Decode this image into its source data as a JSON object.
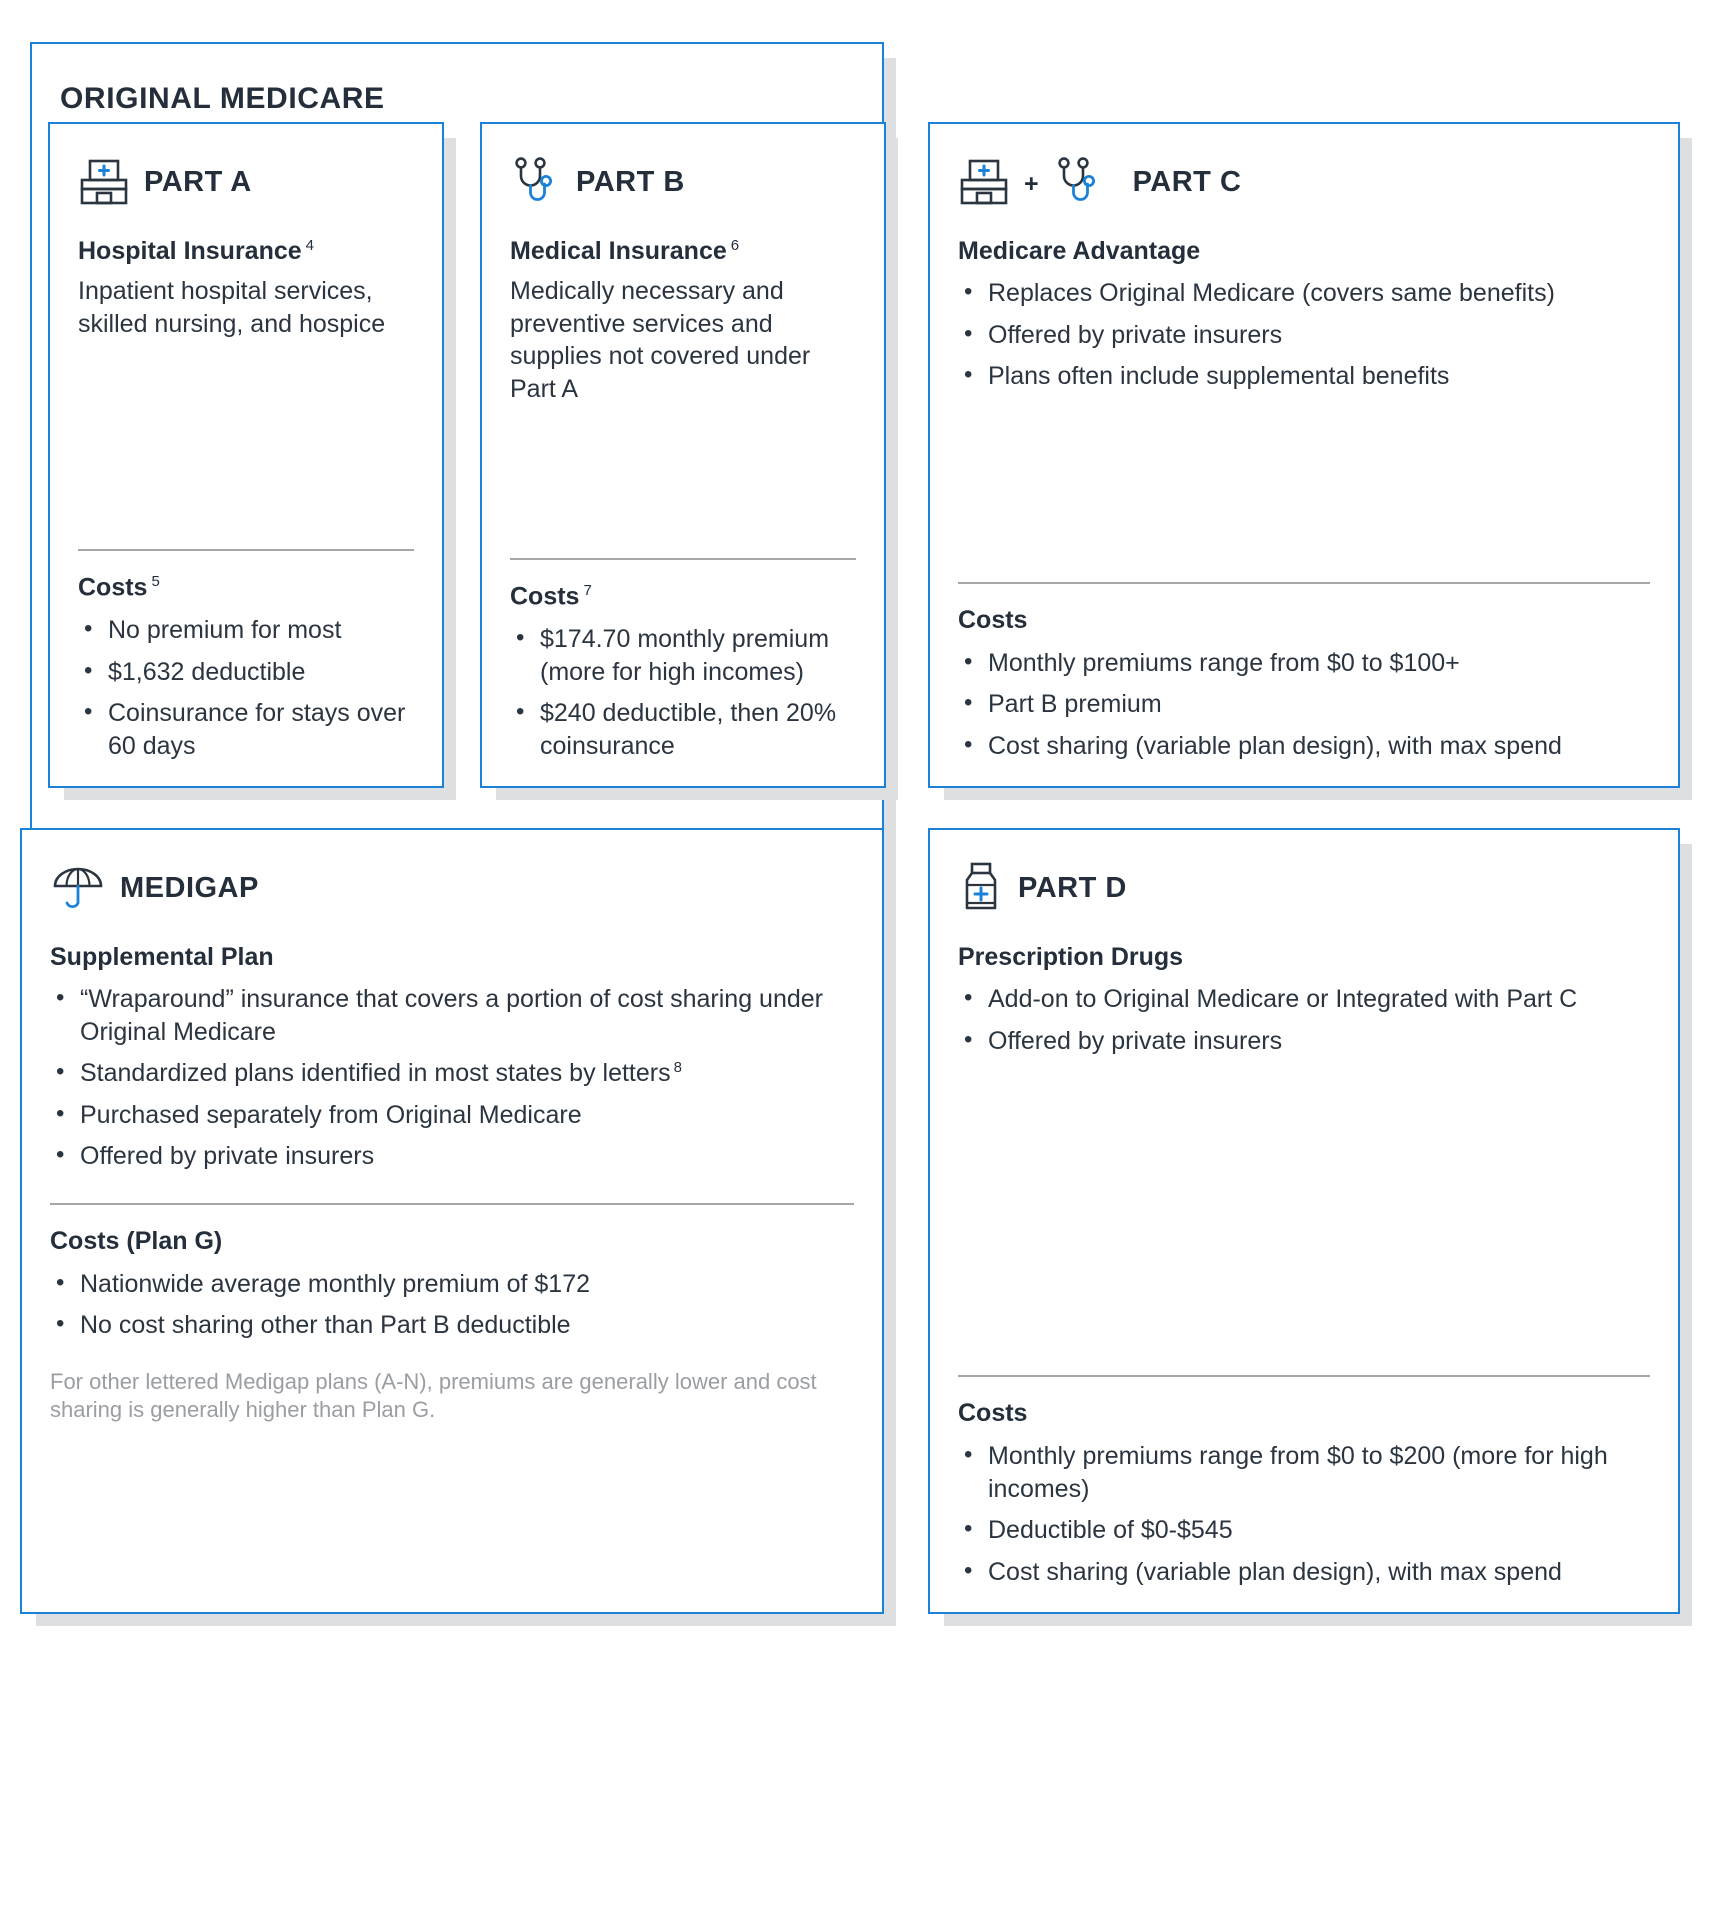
{
  "colors": {
    "accent_blue": "#1a82d8",
    "text_dark": "#242f3b",
    "muted_gray": "#9a9da2",
    "divider": "#a5a7ab",
    "shadow": "#dedfe1"
  },
  "original_medicare": {
    "title": "ORIGINAL MEDICARE"
  },
  "part_a": {
    "icon": "hospital-icon",
    "label": "PART A",
    "heading": "Hospital Insurance",
    "heading_footnote": "4",
    "description": "Inpatient hospital services, skilled nursing, and hospice",
    "costs_label": "Costs",
    "costs_footnote": "5",
    "costs": [
      "No premium for most",
      "$1,632 deductible",
      "Coinsurance for stays over 60 days"
    ]
  },
  "part_b": {
    "icon": "stethoscope-icon",
    "label": "PART B",
    "heading": "Medical Insurance",
    "heading_footnote": "6",
    "description": "Medically necessary and preventive services and supplies not covered under Part A",
    "costs_label": "Costs",
    "costs_footnote": "7",
    "costs": [
      "$174.70 monthly premium (more for high incomes)",
      "$240 deductible, then 20% coinsurance"
    ]
  },
  "part_c": {
    "icon_primary": "hospital-icon",
    "icon_separator": "+",
    "icon_secondary": "stethoscope-icon",
    "label": "PART C",
    "heading": "Medicare Advantage",
    "bullets": [
      "Replaces Original Medicare (covers same benefits)",
      "Offered by private insurers",
      "Plans often include supplemental benefits"
    ],
    "costs_label": "Costs",
    "costs": [
      "Monthly premiums range from $0 to $100+",
      "Part B premium",
      "Cost sharing (variable plan design), with max spend"
    ]
  },
  "medigap": {
    "icon": "umbrella-icon",
    "label": "MEDIGAP",
    "heading": "Supplemental Plan",
    "bullets": [
      "“Wraparound” insurance that covers a portion of cost sharing under Original Medicare",
      "Standardized plans identified in most states by letters",
      "Purchased separately from Original Medicare",
      "Offered by private insurers"
    ],
    "bullet_footnotes": [
      "",
      "8",
      "",
      ""
    ],
    "costs_label": "Costs (Plan G)",
    "costs": [
      "Nationwide average monthly premium of $172",
      "No cost sharing other than Part B deductible"
    ],
    "footnote": "For other lettered Medigap plans (A-N), premiums are generally lower and cost sharing is generally higher than Plan G."
  },
  "part_d": {
    "icon": "pill-bottle-icon",
    "label": "PART D",
    "heading": "Prescription Drugs",
    "bullets": [
      "Add-on to Original Medicare or Integrated with Part C",
      "Offered by private insurers"
    ],
    "costs_label": "Costs",
    "costs": [
      "Monthly premiums range from $0 to $200 (more for high incomes)",
      "Deductible of $0-$545",
      "Cost sharing (variable plan design), with max spend"
    ]
  }
}
